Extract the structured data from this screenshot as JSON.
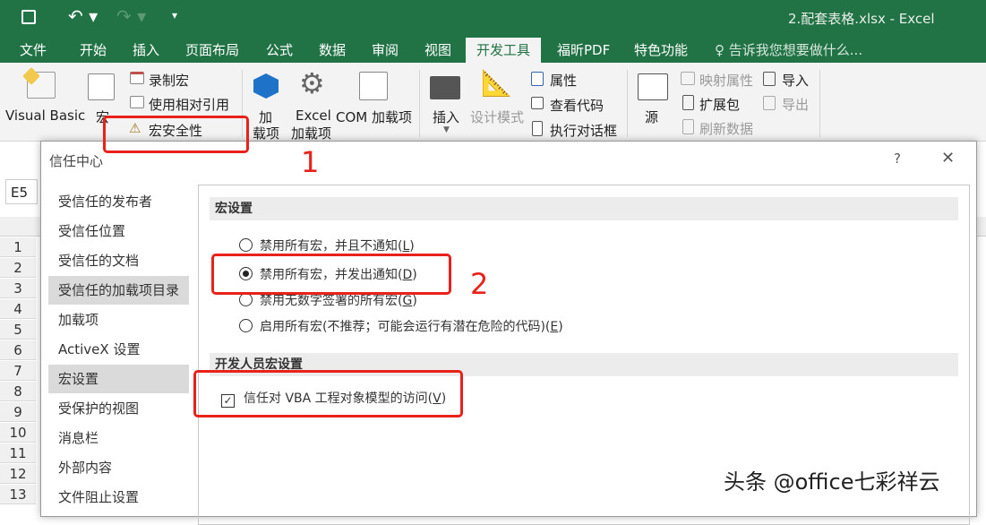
{
  "window": {
    "title": "2.配套表格.xlsx - Excel"
  },
  "tabs": [
    "文件",
    "开始",
    "插入",
    "页面布局",
    "公式",
    "数据",
    "审阅",
    "视图",
    "开发工具",
    "福昕PDF",
    "特色功能"
  ],
  "tell_me": "告诉我您想要做什么...",
  "ribbon": {
    "visual_basic": "Visual Basic",
    "macro": "宏",
    "record_macro": "录制宏",
    "relative_ref": "使用相对引用",
    "macro_security": "宏安全性",
    "addins_1": "加",
    "addins_2": "载项",
    "excel_addins_1": "Excel",
    "excel_addins_2": "加载项",
    "com_addins": "COM 加载项",
    "insert": "插入",
    "design_mode": "设计模式",
    "properties": "属性",
    "view_code": "查看代码",
    "run_dialog": "执行对话框",
    "source": "源",
    "map_props": "映射属性",
    "expansion_pack": "扩展包",
    "refresh_data": "刷新数据",
    "import": "导入",
    "export": "导出"
  },
  "name_box": "E5",
  "rows": [
    "1",
    "2",
    "3",
    "4",
    "5",
    "6",
    "7",
    "8",
    "9",
    "10",
    "11",
    "12",
    "13"
  ],
  "dialog": {
    "title": "信任中心",
    "help": "?",
    "close": "✕",
    "nav": [
      "受信任的发布者",
      "受信任位置",
      "受信任的文档",
      "受信任的加载项目录",
      "加载项",
      "ActiveX 设置",
      "宏设置",
      "受保护的视图",
      "消息栏",
      "外部内容",
      "文件阻止设置"
    ],
    "selected_nav": "宏设置",
    "macro_section": "宏设置",
    "options": [
      {
        "text": "禁用所有宏，并且不通知(",
        "key": "L",
        "selected": false
      },
      {
        "text": "禁用所有宏，并发出通知(",
        "key": "D",
        "selected": true
      },
      {
        "text": "禁用无数字签署的所有宏(",
        "key": "G",
        "selected": false
      },
      {
        "text": "启用所有宏(不推荐；可能会运行有潜在危险的代码)(",
        "key": "E",
        "selected": false
      }
    ],
    "dev_section": "开发人员宏设置",
    "vba_trust": {
      "text": "信任对 VBA 工程对象模型的访问(",
      "key": "V",
      "checked": true
    }
  },
  "annotations": {
    "step1": "1",
    "step2": "2"
  },
  "watermark": "头条 @office七彩祥云",
  "colors": {
    "excel_green": "#217346",
    "annotation_red": "#e8221b"
  }
}
